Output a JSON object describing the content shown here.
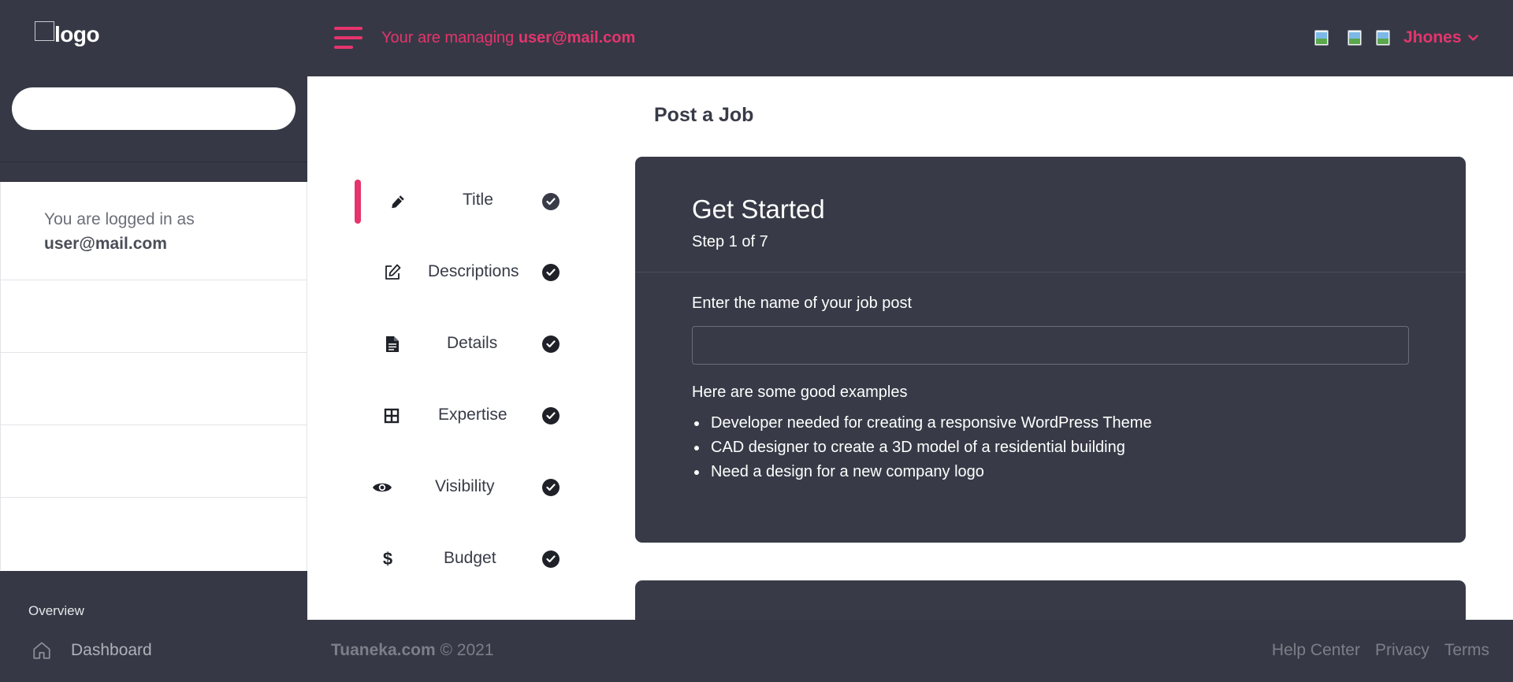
{
  "header": {
    "logo_text": "logo",
    "managing_prefix": "Your are managing",
    "managing_email": "user@mail.com",
    "user_name": "Jhones"
  },
  "sidebar": {
    "search_placeholder": "",
    "login_label": "You are logged in as",
    "login_email": "user@mail.com",
    "section_title": "Overview",
    "nav": [
      {
        "label": "Dashboard",
        "icon": "home-icon"
      }
    ]
  },
  "steps": [
    {
      "label": "Title",
      "icon": "pen-icon",
      "completed": true,
      "active": true
    },
    {
      "label": "Descriptions",
      "icon": "edit-icon",
      "completed": true,
      "active": false
    },
    {
      "label": "Details",
      "icon": "document-icon",
      "completed": true,
      "active": false
    },
    {
      "label": "Expertise",
      "icon": "grid-icon",
      "completed": true,
      "active": false
    },
    {
      "label": "Visibility",
      "icon": "eye-icon",
      "completed": true,
      "active": false
    },
    {
      "label": "Budget",
      "icon": "dollar-icon",
      "completed": true,
      "active": false
    }
  ],
  "main": {
    "page_title": "Post a Job",
    "card": {
      "title": "Get Started",
      "step_text": "Step 1 of 7",
      "field_label": "Enter the name of your job post",
      "field_value": "",
      "examples_label": "Here are some good examples",
      "examples": [
        "Developer needed for creating a responsive WordPress Theme",
        "CAD designer to create a 3D model of a residential building",
        "Need a design for a new company logo"
      ]
    }
  },
  "footer": {
    "brand": "Tuaneka.com",
    "copyright": "© 2021",
    "links": [
      "Help Center",
      "Privacy",
      "Terms"
    ]
  },
  "colors": {
    "accent": "#e6346d",
    "dark": "#363945",
    "card": "#383b47"
  }
}
